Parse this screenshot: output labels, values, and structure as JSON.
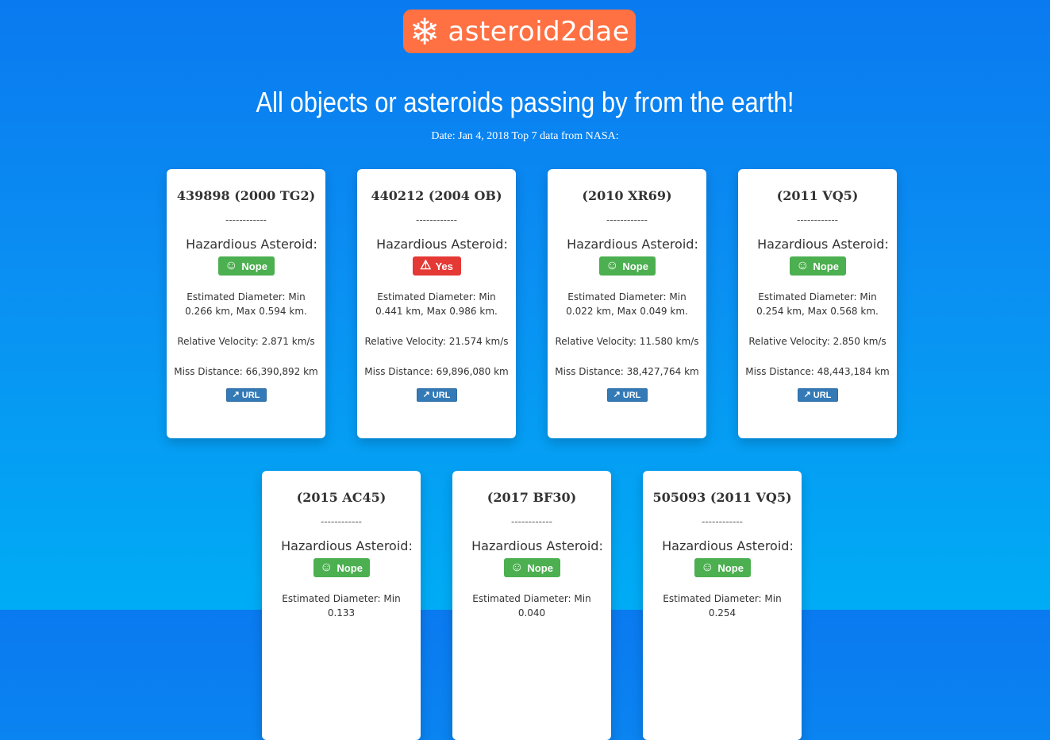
{
  "header": {
    "logo_text": "asteroid2dae",
    "logo_icon": "snowflake-icon",
    "headline": "All objects or asteroids passing by from the earth!",
    "subline": "Date: Jan 4, 2018 Top 7 data from NASA:"
  },
  "colors": {
    "logo_bg": "#ff7043",
    "safe": "#4caf50",
    "danger": "#e53935",
    "url_button": "#337ab7"
  },
  "cards": [
    {
      "title": "439898 (2000 TG2)",
      "separator": "------------",
      "hazard_label": "Hazardious Asteroid:",
      "hazard": "Nope",
      "hazard_icon": "smile-icon",
      "diameter": "Estimated Diameter: Min 0.266 km, Max 0.594 km.",
      "velocity": "Relative Velocity: 2.871 km/s",
      "miss": "Miss Distance: 66,390,892 km",
      "url_label": "URL"
    },
    {
      "title": "440212 (2004 OB)",
      "separator": "------------",
      "hazard_label": "Hazardious Asteroid:",
      "hazard": "Yes",
      "hazard_icon": "warning-icon",
      "diameter": "Estimated Diameter: Min 0.441 km, Max 0.986 km.",
      "velocity": "Relative Velocity: 21.574 km/s",
      "miss": "Miss Distance: 69,896,080 km",
      "url_label": "URL"
    },
    {
      "title": "(2010 XR69)",
      "separator": "------------",
      "hazard_label": "Hazardious Asteroid:",
      "hazard": "Nope",
      "hazard_icon": "smile-icon",
      "diameter": "Estimated Diameter: Min 0.022 km, Max 0.049 km.",
      "velocity": "Relative Velocity: 11.580 km/s",
      "miss": "Miss Distance: 38,427,764 km",
      "url_label": "URL"
    },
    {
      "title": "(2011 VQ5)",
      "separator": "------------",
      "hazard_label": "Hazardious Asteroid:",
      "hazard": "Nope",
      "hazard_icon": "smile-icon",
      "diameter": "Estimated Diameter: Min 0.254 km, Max 0.568 km.",
      "velocity": "Relative Velocity: 2.850 km/s",
      "miss": "Miss Distance: 48,443,184 km",
      "url_label": "URL"
    },
    {
      "title": "(2015 AC45)",
      "separator": "------------",
      "hazard_label": "Hazardious Asteroid:",
      "hazard": "Nope",
      "hazard_icon": "smile-icon",
      "diameter": "Estimated Diameter: Min 0.133",
      "velocity": "",
      "miss": "",
      "url_label": ""
    },
    {
      "title": "(2017 BF30)",
      "separator": "------------",
      "hazard_label": "Hazardious Asteroid:",
      "hazard": "Nope",
      "hazard_icon": "smile-icon",
      "diameter": "Estimated Diameter: Min 0.040",
      "velocity": "",
      "miss": "",
      "url_label": ""
    },
    {
      "title": "505093 (2011 VQ5)",
      "separator": "------------",
      "hazard_label": "Hazardious Asteroid:",
      "hazard": "Nope",
      "hazard_icon": "smile-icon",
      "diameter": "Estimated Diameter: Min 0.254",
      "velocity": "",
      "miss": "",
      "url_label": ""
    }
  ]
}
